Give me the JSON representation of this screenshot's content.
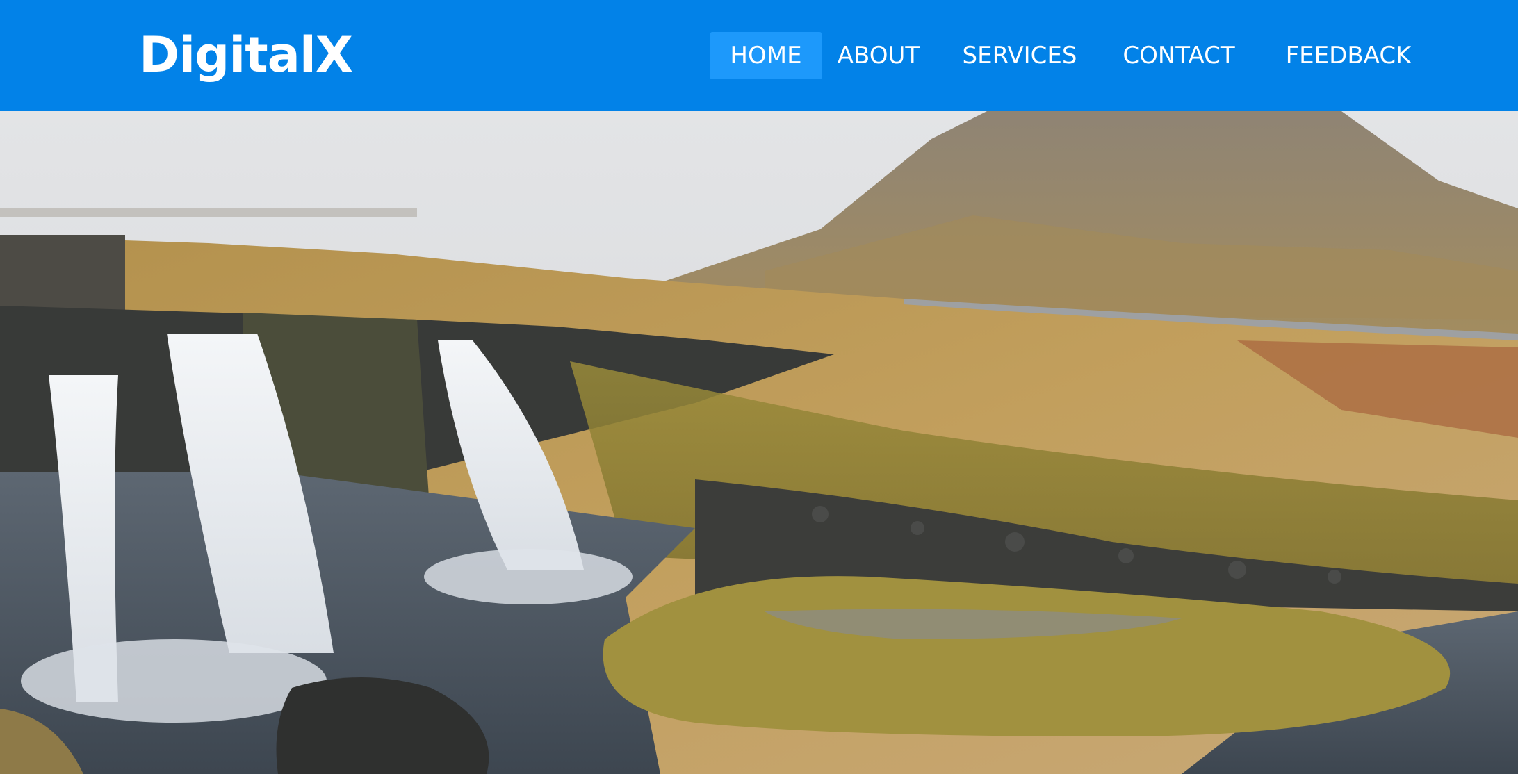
{
  "navbar": {
    "brand": "DigitalX",
    "links": [
      {
        "label": "HOME",
        "active": true
      },
      {
        "label": "ABOUT",
        "active": false
      },
      {
        "label": "SERVICES",
        "active": false
      },
      {
        "label": "CONTACT",
        "active": false
      },
      {
        "label": "FEEDBACK",
        "active": false
      }
    ]
  },
  "theme": {
    "navbar_bg": "#0282e8",
    "active_link_bg": "#1d99fb",
    "text_color": "#ffffff"
  }
}
